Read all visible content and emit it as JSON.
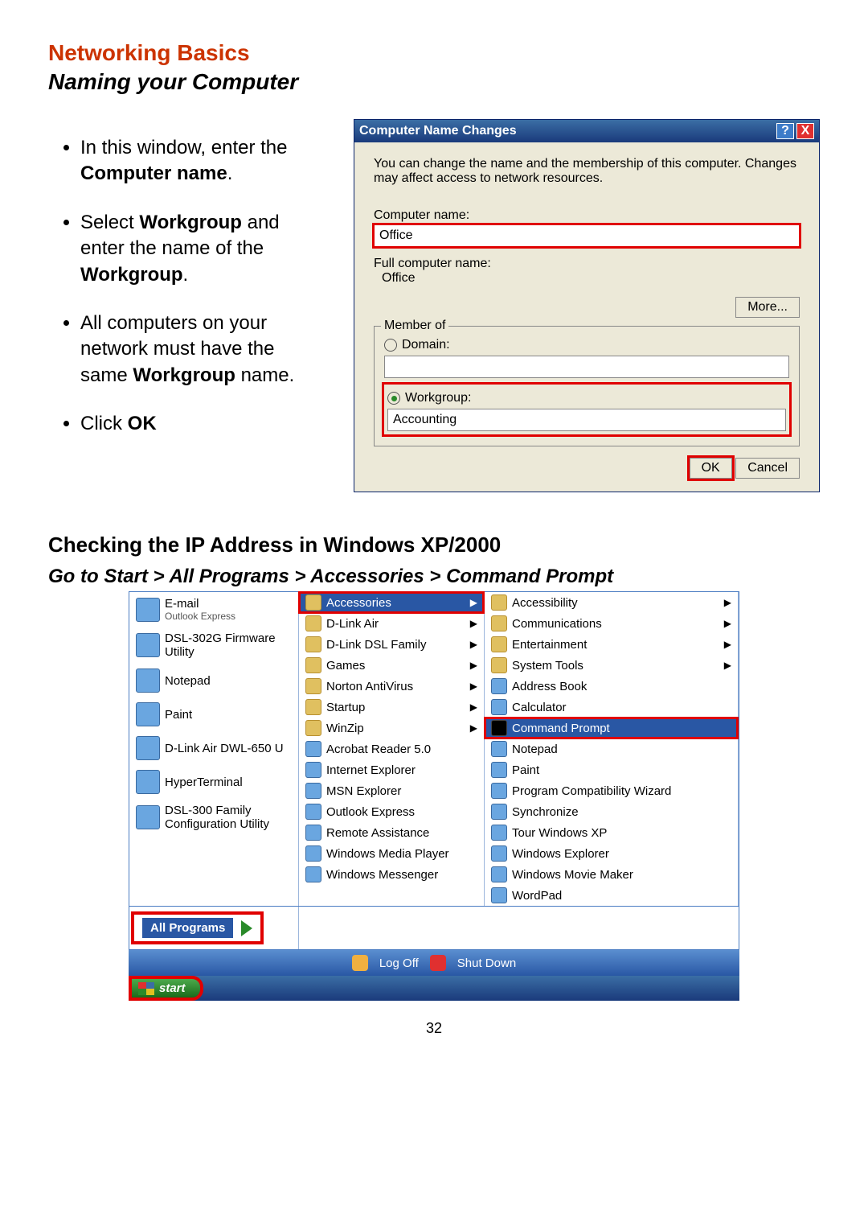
{
  "header": {
    "title": "Networking Basics",
    "subtitle": "Naming your Computer"
  },
  "bullets": [
    {
      "pre": "In this window, enter the ",
      "bold": "Computer name",
      "post": "."
    },
    {
      "pre": "Select ",
      "bold": "Workgroup",
      "post": " and enter the name of the ",
      "bold2": "Workgroup",
      "post2": "."
    },
    {
      "pre": "All computers on your network must have the same ",
      "bold": "Workgroup",
      "post": " name."
    },
    {
      "pre": " Click ",
      "bold": "OK",
      "post": ""
    }
  ],
  "dialog": {
    "title": "Computer Name Changes",
    "desc": "You can change the name and the membership of this computer. Changes may affect access to network resources.",
    "computer_name_label": "Computer name:",
    "computer_name_value": "Office",
    "full_name_label": "Full computer name:",
    "full_name_value": "Office",
    "more_btn": "More...",
    "member_legend": "Member of",
    "domain_label": "Domain:",
    "workgroup_label": "Workgroup:",
    "workgroup_value": "Accounting",
    "ok": "OK",
    "cancel": "Cancel"
  },
  "section2": {
    "heading": "Checking the IP Address in Windows XP/2000",
    "path": "Go to Start > All Programs > Accessories > Command Prompt"
  },
  "xp": {
    "left": [
      {
        "title": "E-mail",
        "sub": "Outlook Express"
      },
      {
        "title": "DSL-302G Firmware Utility",
        "sub": ""
      },
      {
        "title": "Notepad",
        "sub": ""
      },
      {
        "title": "Paint",
        "sub": ""
      },
      {
        "title": "D-Link Air DWL-650 U",
        "sub": ""
      },
      {
        "title": "HyperTerminal",
        "sub": ""
      },
      {
        "title": "DSL-300 Family Configuration Utility",
        "sub": ""
      }
    ],
    "all_programs": "All Programs",
    "mid": [
      {
        "label": "Accessories",
        "arrow": true,
        "hl": true,
        "folder": true
      },
      {
        "label": "D-Link Air",
        "arrow": true,
        "folder": true
      },
      {
        "label": "D-Link DSL Family",
        "arrow": true,
        "folder": true
      },
      {
        "label": "Games",
        "arrow": true,
        "folder": true
      },
      {
        "label": "Norton AntiVirus",
        "arrow": true,
        "folder": true
      },
      {
        "label": "Startup",
        "arrow": true,
        "folder": true
      },
      {
        "label": "WinZip",
        "arrow": true,
        "folder": true
      },
      {
        "label": "Acrobat Reader 5.0",
        "arrow": false,
        "folder": false
      },
      {
        "label": "Internet Explorer",
        "arrow": false,
        "folder": false
      },
      {
        "label": "MSN Explorer",
        "arrow": false,
        "folder": false
      },
      {
        "label": "Outlook Express",
        "arrow": false,
        "folder": false
      },
      {
        "label": "Remote Assistance",
        "arrow": false,
        "folder": false
      },
      {
        "label": "Windows Media Player",
        "arrow": false,
        "folder": false
      },
      {
        "label": "Windows Messenger",
        "arrow": false,
        "folder": false
      }
    ],
    "right": [
      {
        "label": "Accessibility",
        "arrow": true,
        "folder": true
      },
      {
        "label": "Communications",
        "arrow": true,
        "folder": true
      },
      {
        "label": "Entertainment",
        "arrow": true,
        "folder": true
      },
      {
        "label": "System Tools",
        "arrow": true,
        "folder": true
      },
      {
        "label": "Address Book",
        "arrow": false,
        "folder": false
      },
      {
        "label": "Calculator",
        "arrow": false,
        "folder": false
      },
      {
        "label": "Command Prompt",
        "arrow": false,
        "hl": true,
        "cmd": true
      },
      {
        "label": "Notepad",
        "arrow": false,
        "folder": false
      },
      {
        "label": "Paint",
        "arrow": false,
        "folder": false
      },
      {
        "label": "Program Compatibility Wizard",
        "arrow": false,
        "folder": false
      },
      {
        "label": "Synchronize",
        "arrow": false,
        "folder": false
      },
      {
        "label": "Tour Windows XP",
        "arrow": false,
        "folder": false
      },
      {
        "label": "Windows Explorer",
        "arrow": false,
        "folder": false
      },
      {
        "label": "Windows Movie Maker",
        "arrow": false,
        "folder": false
      },
      {
        "label": "WordPad",
        "arrow": false,
        "folder": false
      }
    ],
    "log_off": "Log Off",
    "shut_down": "Shut Down",
    "start": "start"
  },
  "page_number": "32"
}
